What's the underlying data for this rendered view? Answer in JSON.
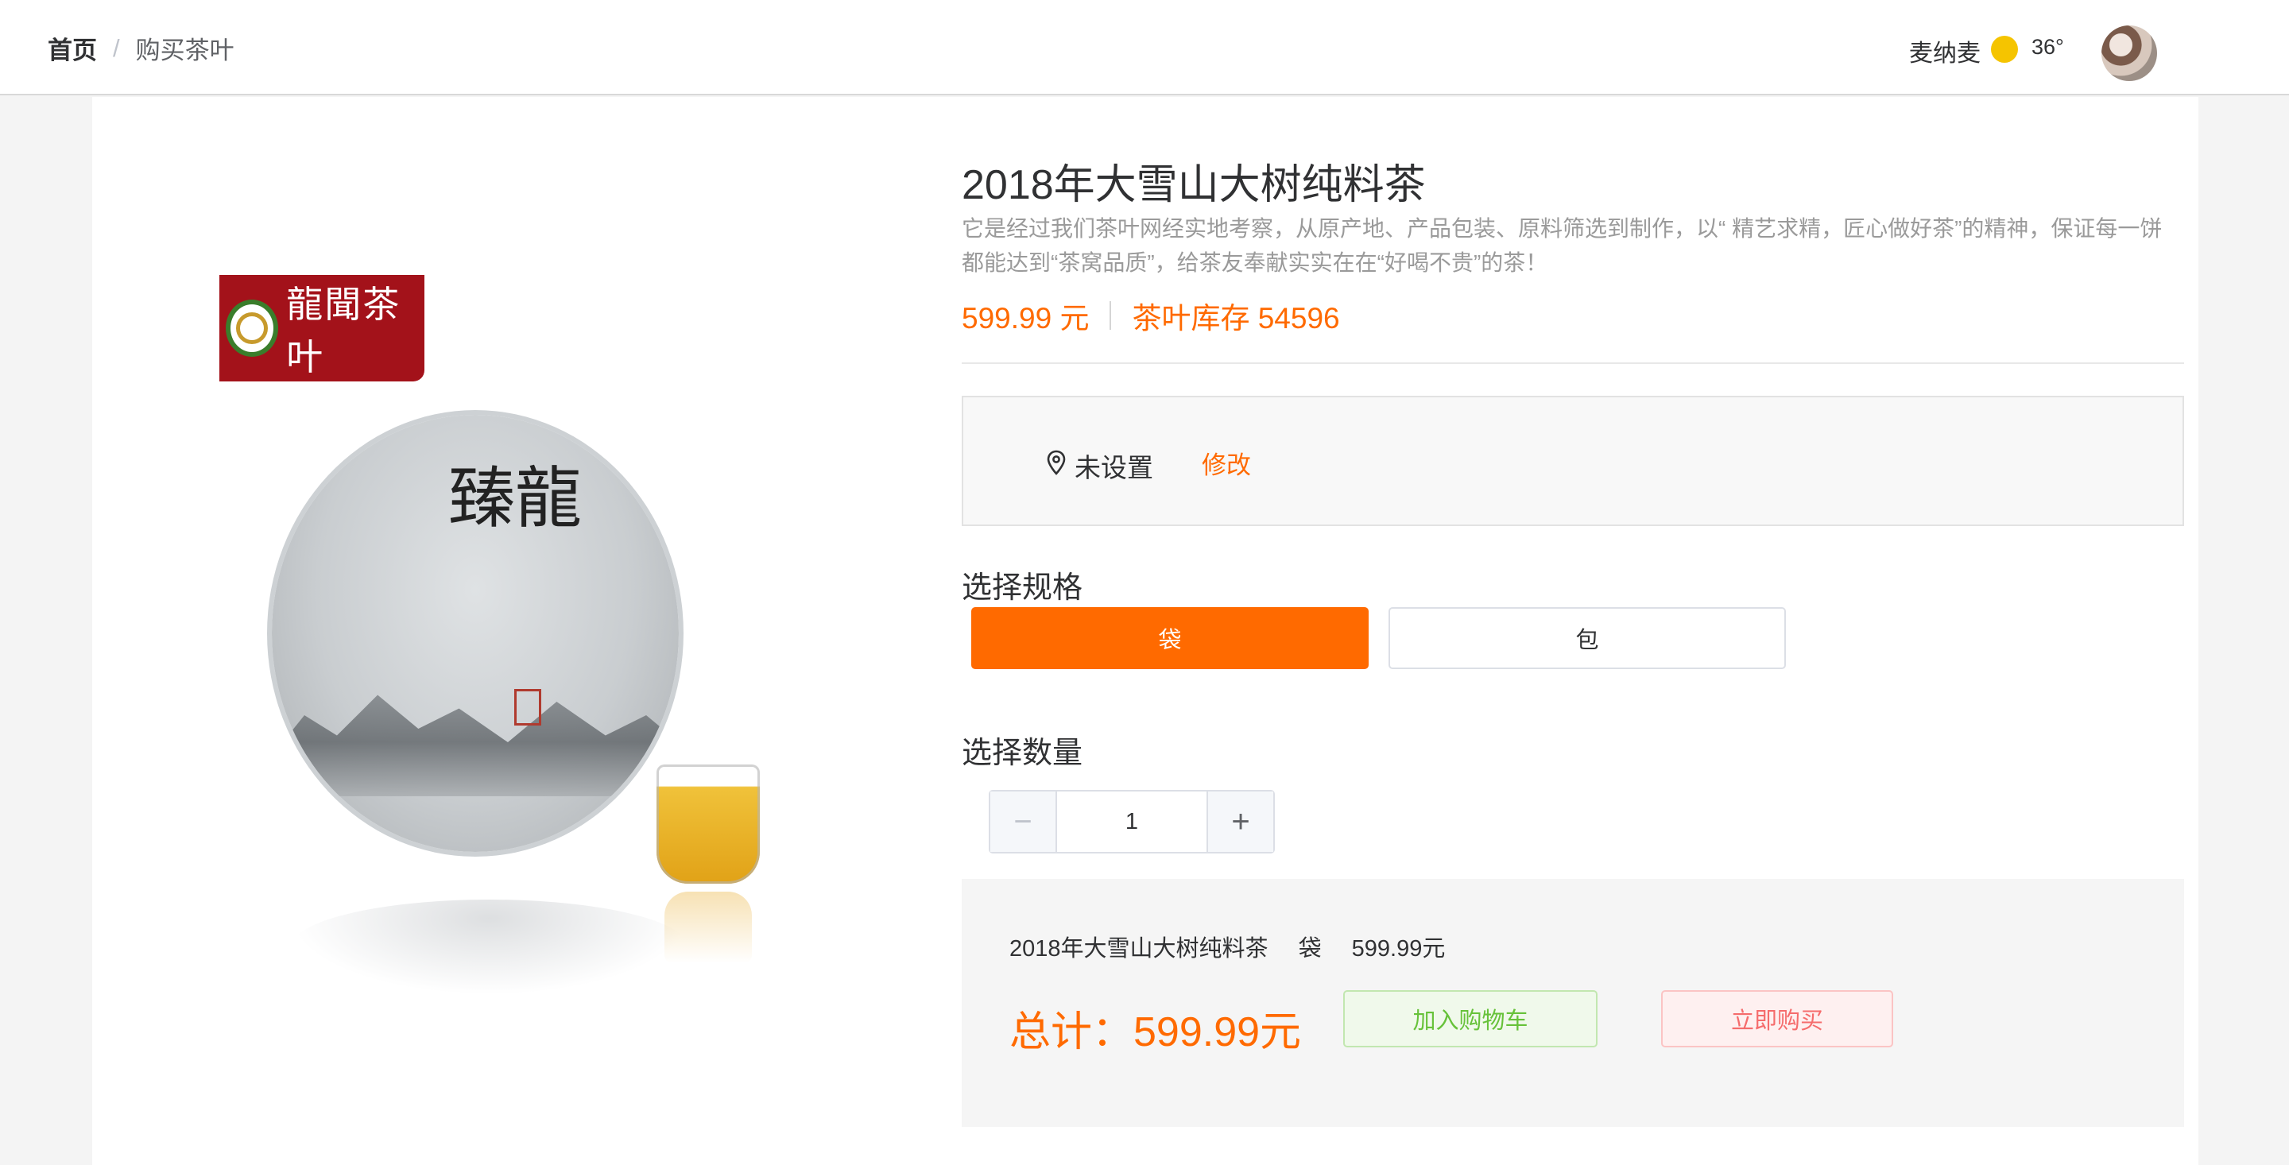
{
  "header": {
    "breadcrumb": {
      "home": "首页",
      "separator": "/",
      "current": "购买茶叶"
    },
    "user": {
      "name": "麦纳麦",
      "weather_icon": "sun-icon",
      "temperature": "36°"
    }
  },
  "product": {
    "title": "2018年大雪山大树纯料茶",
    "description": "它是经过我们茶叶网经实地考察，从原产地、产品包装、原料筛选到制作，以“ 精艺求精，匠心做好茶”的精神，保证每一饼都能达到“茶窝品质”，给茶友奉献实实在在“好喝不贵”的茶！",
    "price": "599.99 元",
    "stock": "茶叶库存 54596",
    "image": {
      "brand_text": "龍聞茶叶",
      "cake_text": "臻龍"
    }
  },
  "address": {
    "value": "未设置",
    "edit_label": "修改"
  },
  "spec": {
    "label": "选择规格",
    "options": [
      "袋",
      "包"
    ],
    "selected": "袋"
  },
  "quantity": {
    "label": "选择数量",
    "value": "1",
    "minus": "−",
    "plus": "+"
  },
  "summary": {
    "name": "2018年大雪山大树纯料茶",
    "spec": "袋",
    "price": "599.99元",
    "total": "总计：599.99元",
    "add_to_cart": "加入购物车",
    "buy_now": "立即购买"
  },
  "colors": {
    "accent": "#ff6a00",
    "cart_text": "#67c23a",
    "buy_text": "#f56c6c",
    "weather_sun": "#f5c400"
  }
}
